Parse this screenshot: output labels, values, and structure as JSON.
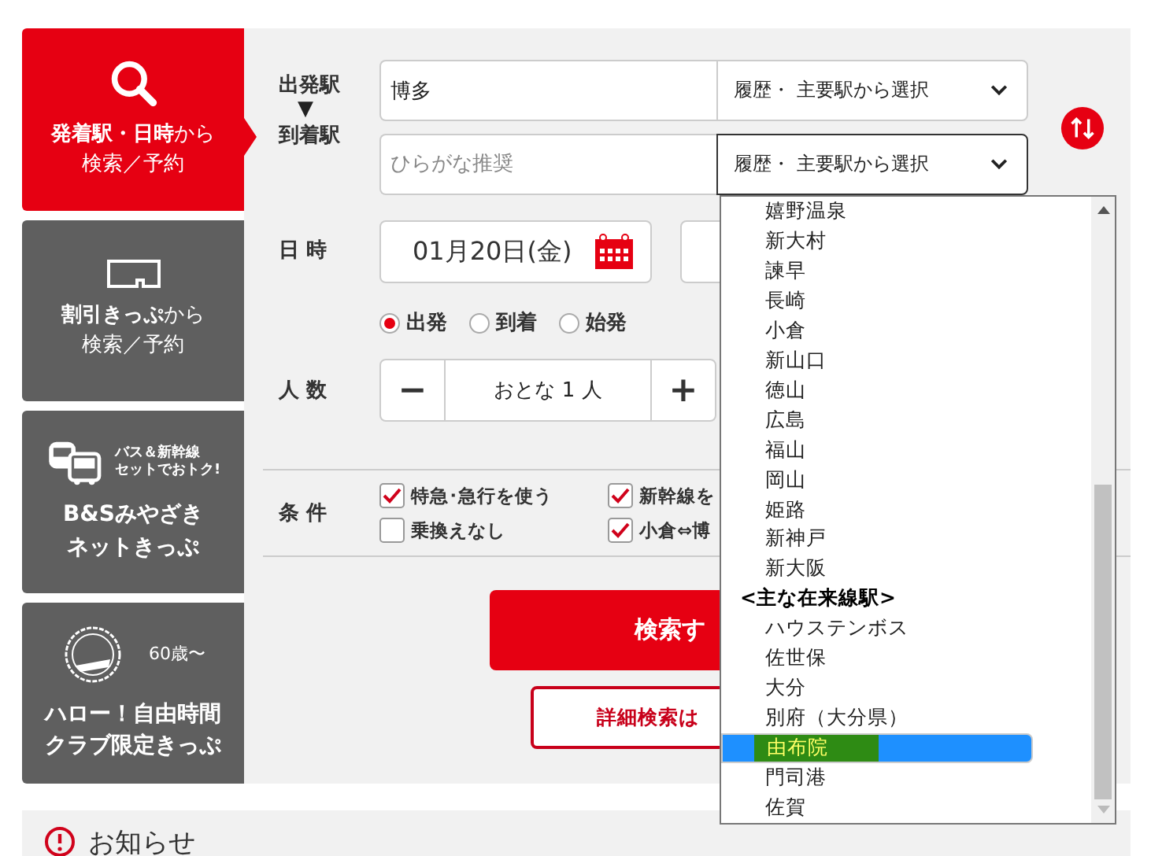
{
  "sidebar": {
    "tabs": [
      {
        "kind": "search",
        "selected": true,
        "title": [
          "**発着駅・日時**から",
          "検索／予約"
        ]
      },
      {
        "kind": "ticket",
        "selected": false,
        "title": [
          "**割引きっぷ**から",
          "検索／予約"
        ]
      },
      {
        "kind": "bus",
        "selected": false,
        "badge": [
          "バス＆新幹線",
          "セットでおトク!"
        ],
        "title": [
          "B&Sみやざき",
          "ネットきっぷ"
        ]
      },
      {
        "kind": "stamp",
        "selected": false,
        "badge": [
          "60歳〜"
        ],
        "title": [
          "ハロー！自由時間",
          "クラブ限定きっぷ"
        ]
      }
    ]
  },
  "form": {
    "stations": {
      "departure_label": "出発駅",
      "arrow": "▼",
      "arrival_label": "到着駅",
      "departure": {
        "value": "博多",
        "select": "履歴・ 主要駅から選択",
        "focused": false
      },
      "arrival": {
        "placeholder": "ひらがな推奨",
        "select": "履歴・ 主要駅から選択",
        "focused": true
      }
    },
    "datetime": {
      "label": "日 時",
      "date": "01月20日(金)",
      "radios": [
        {
          "label": "出発",
          "selected": true
        },
        {
          "label": "到着",
          "selected": false
        },
        {
          "label": "始発",
          "selected": false
        }
      ]
    },
    "persons": {
      "label": "人 数",
      "minus": "−",
      "value": "おとな 1 人",
      "plus": "+"
    },
    "conditions": {
      "label": "条 件",
      "options": [
        {
          "label": "特急･急行を使う",
          "checked": true
        },
        {
          "label": "新幹線を",
          "checked": true
        },
        {
          "label": "乗換えなし",
          "checked": false
        },
        {
          "label": "小倉⇔博",
          "checked": true
        }
      ]
    },
    "search_button": "検索す",
    "detail_button": "詳細検索は"
  },
  "station_dropdown": {
    "items": [
      {
        "kind": "station",
        "label": "嬉野温泉",
        "selected": false
      },
      {
        "kind": "station",
        "label": "新大村",
        "selected": false
      },
      {
        "kind": "station",
        "label": "諫早",
        "selected": false
      },
      {
        "kind": "station",
        "label": "長崎",
        "selected": false
      },
      {
        "kind": "station",
        "label": "小倉",
        "selected": false
      },
      {
        "kind": "station",
        "label": "新山口",
        "selected": false
      },
      {
        "kind": "station",
        "label": "徳山",
        "selected": false
      },
      {
        "kind": "station",
        "label": "広島",
        "selected": false
      },
      {
        "kind": "station",
        "label": "福山",
        "selected": false
      },
      {
        "kind": "station",
        "label": "岡山",
        "selected": false
      },
      {
        "kind": "station",
        "label": "姫路",
        "selected": false
      },
      {
        "kind": "station",
        "label": "新神戸",
        "selected": false
      },
      {
        "kind": "station",
        "label": "新大阪",
        "selected": false
      },
      {
        "kind": "group",
        "label": "<主な在来線駅>",
        "selected": false
      },
      {
        "kind": "station",
        "label": "ハウステンボス",
        "selected": false
      },
      {
        "kind": "station",
        "label": "佐世保",
        "selected": false
      },
      {
        "kind": "station",
        "label": "大分",
        "selected": false
      },
      {
        "kind": "station",
        "label": "別府（大分県）",
        "selected": false
      },
      {
        "kind": "station",
        "label": "由布院",
        "selected": true
      },
      {
        "kind": "station",
        "label": "門司港",
        "selected": false
      },
      {
        "kind": "station",
        "label": "佐賀",
        "selected": false
      }
    ]
  },
  "notice": {
    "title": "お知らせ"
  }
}
